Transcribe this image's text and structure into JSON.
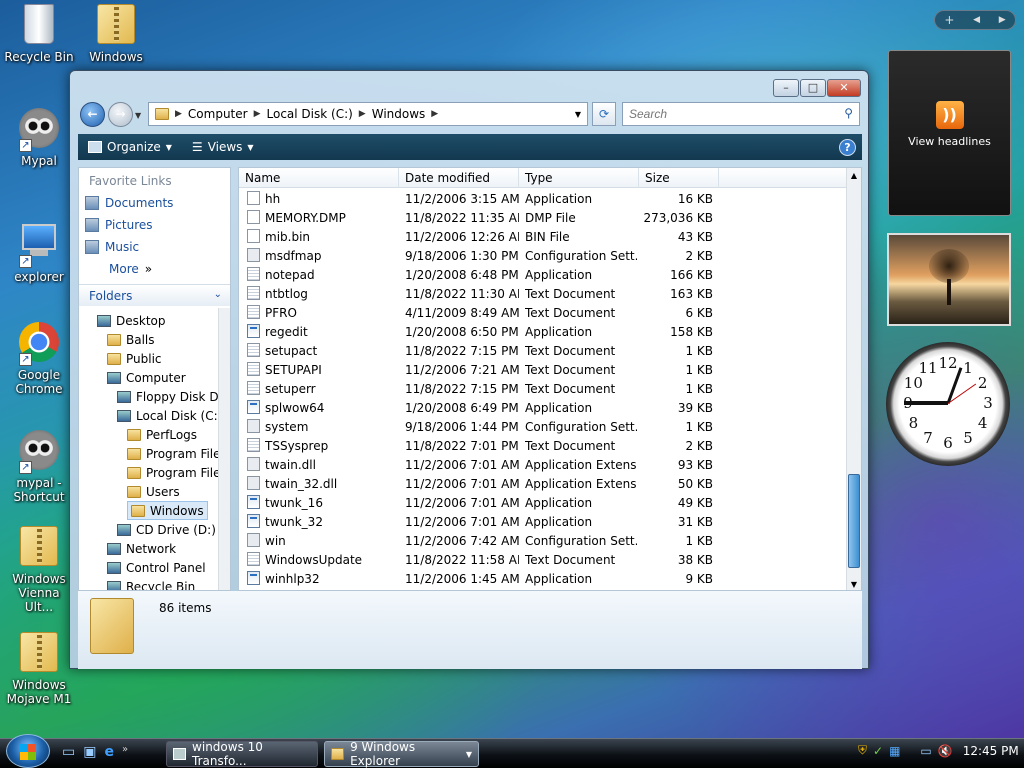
{
  "desktop": {
    "icons": [
      {
        "label": "Recycle Bin",
        "icon": "recycle-bin-icon"
      },
      {
        "label": "Windows",
        "icon": "zip-folder-icon"
      },
      {
        "label": "Mypal",
        "icon": "raccoon-icon"
      },
      {
        "label": "explorer",
        "icon": "computer-icon"
      },
      {
        "label": "Google Chrome",
        "icon": "chrome-icon"
      },
      {
        "label": "mypal - Shortcut",
        "icon": "raccoon-icon"
      },
      {
        "label": "Windows Vienna Ult...",
        "icon": "zip-folder-icon"
      },
      {
        "label": "Windows Mojave M1",
        "icon": "zip-folder-icon"
      }
    ]
  },
  "window": {
    "title": "Windows Explorer",
    "address": {
      "crumbs": [
        "Computer",
        "Local Disk (C:)",
        "Windows"
      ]
    },
    "search_placeholder": "Search",
    "toolbar": {
      "organize": "Organize",
      "views": "Views"
    },
    "nav": {
      "favorite_links_title": "Favorite Links",
      "favorite_links": [
        "Documents",
        "Pictures",
        "Music"
      ],
      "more": "More",
      "folders_title": "Folders",
      "tree": [
        {
          "label": "Desktop",
          "level": 0
        },
        {
          "label": "Balls",
          "level": 1
        },
        {
          "label": "Public",
          "level": 1
        },
        {
          "label": "Computer",
          "level": 1
        },
        {
          "label": "Floppy Disk Dr",
          "level": 2
        },
        {
          "label": "Local Disk (C:)",
          "level": 2
        },
        {
          "label": "PerfLogs",
          "level": 3
        },
        {
          "label": "Program File",
          "level": 3
        },
        {
          "label": "Program File",
          "level": 3
        },
        {
          "label": "Users",
          "level": 3
        },
        {
          "label": "Windows",
          "level": 3
        },
        {
          "label": "CD Drive (D:) N",
          "level": 2
        },
        {
          "label": "Network",
          "level": 1
        },
        {
          "label": "Control Panel",
          "level": 1
        },
        {
          "label": "Recycle Bin",
          "level": 1
        }
      ]
    },
    "columns": [
      "Name",
      "Date modified",
      "Type",
      "Size"
    ],
    "files": [
      {
        "name": "hh",
        "date": "11/2/2006 3:15 AM",
        "type": "Application",
        "size": "16 KB",
        "icon": "help-icon"
      },
      {
        "name": "MEMORY.DMP",
        "date": "11/8/2022 11:35 AM",
        "type": "DMP File",
        "size": "273,036 KB",
        "icon": "file-icon"
      },
      {
        "name": "mib.bin",
        "date": "11/2/2006 12:26 AM",
        "type": "BIN File",
        "size": "43 KB",
        "icon": "file-icon"
      },
      {
        "name": "msdfmap",
        "date": "9/18/2006 1:30 PM",
        "type": "Configuration Sett...",
        "size": "2 KB",
        "icon": "config-icon"
      },
      {
        "name": "notepad",
        "date": "1/20/2008 6:48 PM",
        "type": "Application",
        "size": "166 KB",
        "icon": "notepad-icon"
      },
      {
        "name": "ntbtlog",
        "date": "11/8/2022 11:30 AM",
        "type": "Text Document",
        "size": "163 KB",
        "icon": "text-file-icon"
      },
      {
        "name": "PFRO",
        "date": "4/11/2009 8:49 AM",
        "type": "Text Document",
        "size": "6 KB",
        "icon": "text-file-icon"
      },
      {
        "name": "regedit",
        "date": "1/20/2008 6:50 PM",
        "type": "Application",
        "size": "158 KB",
        "icon": "regedit-icon"
      },
      {
        "name": "setupact",
        "date": "11/8/2022 7:15 PM",
        "type": "Text Document",
        "size": "1 KB",
        "icon": "text-file-icon"
      },
      {
        "name": "SETUPAPI",
        "date": "11/2/2006 7:21 AM",
        "type": "Text Document",
        "size": "1 KB",
        "icon": "text-file-icon"
      },
      {
        "name": "setuperr",
        "date": "11/8/2022 7:15 PM",
        "type": "Text Document",
        "size": "1 KB",
        "icon": "text-file-icon"
      },
      {
        "name": "splwow64",
        "date": "1/20/2008 6:49 PM",
        "type": "Application",
        "size": "39 KB",
        "icon": "app-icon"
      },
      {
        "name": "system",
        "date": "9/18/2006 1:44 PM",
        "type": "Configuration Sett...",
        "size": "1 KB",
        "icon": "config-icon"
      },
      {
        "name": "TSSysprep",
        "date": "11/8/2022 7:01 PM",
        "type": "Text Document",
        "size": "2 KB",
        "icon": "text-file-icon"
      },
      {
        "name": "twain.dll",
        "date": "11/2/2006 7:01 AM",
        "type": "Application Extens...",
        "size": "93 KB",
        "icon": "dll-icon"
      },
      {
        "name": "twain_32.dll",
        "date": "11/2/2006 7:01 AM",
        "type": "Application Extens...",
        "size": "50 KB",
        "icon": "dll-icon"
      },
      {
        "name": "twunk_16",
        "date": "11/2/2006 7:01 AM",
        "type": "Application",
        "size": "49 KB",
        "icon": "app-icon"
      },
      {
        "name": "twunk_32",
        "date": "11/2/2006 7:01 AM",
        "type": "Application",
        "size": "31 KB",
        "icon": "app-icon"
      },
      {
        "name": "win",
        "date": "11/2/2006 7:42 AM",
        "type": "Configuration Sett...",
        "size": "1 KB",
        "icon": "config-icon"
      },
      {
        "name": "WindowsUpdate",
        "date": "11/8/2022 11:58 AM",
        "type": "Text Document",
        "size": "38 KB",
        "icon": "text-file-icon"
      },
      {
        "name": "winhlp32",
        "date": "11/2/2006 1:45 AM",
        "type": "Application",
        "size": "9 KB",
        "icon": "app-icon"
      }
    ],
    "details": {
      "item_count": "86 items"
    }
  },
  "sidebar": {
    "feed_label": "View headlines",
    "clock_numbers": [
      "12",
      "1",
      "2",
      "3",
      "4",
      "5",
      "6",
      "7",
      "8",
      "9",
      "10",
      "11"
    ]
  },
  "taskbar": {
    "tasks": [
      {
        "label": "windows 10 Transfo...",
        "icon": "app-icon"
      },
      {
        "label": "9 Windows Explorer",
        "icon": "folder-icon"
      }
    ],
    "clock": "12:45 PM"
  }
}
